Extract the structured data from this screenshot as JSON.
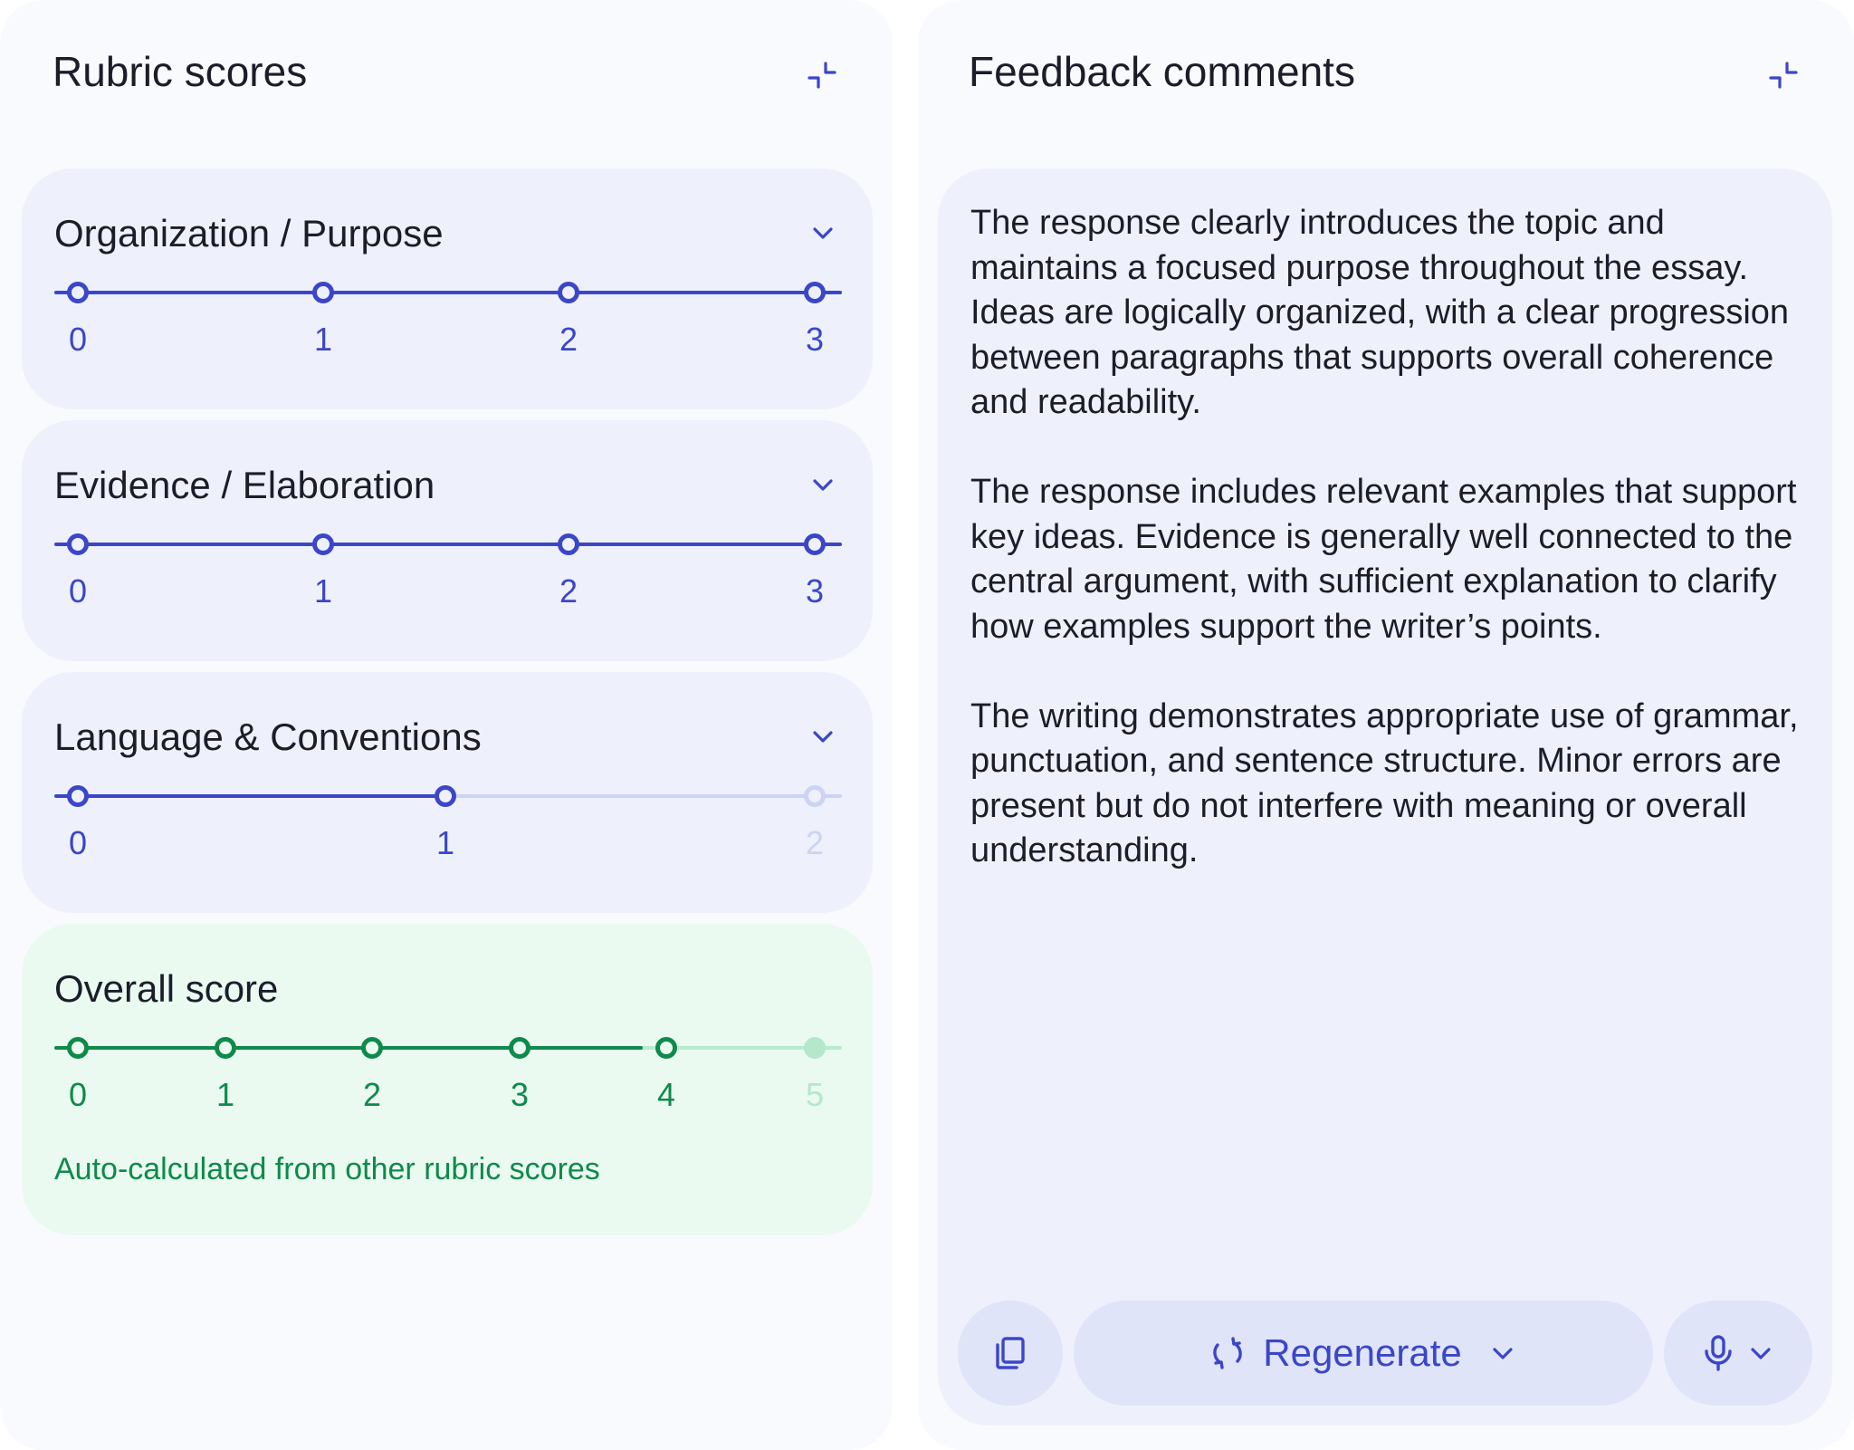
{
  "left": {
    "title": "Rubric scores",
    "collapse_icon": "collapse-icon",
    "cards": [
      {
        "title": "Organization / Purpose",
        "ticks": [
          "0",
          "1",
          "2",
          "3"
        ],
        "score": 3,
        "max": 3
      },
      {
        "title": "Evidence / Elaboration",
        "ticks": [
          "0",
          "1",
          "2",
          "3"
        ],
        "score": 3,
        "max": 3
      },
      {
        "title": "Language & Conventions",
        "ticks": [
          "0",
          "1",
          "2"
        ],
        "score": 1,
        "max": 2
      }
    ],
    "overall": {
      "title": "Overall score",
      "ticks": [
        "0",
        "1",
        "2",
        "3",
        "4",
        "5"
      ],
      "score": 4,
      "max": 5,
      "note": "Auto-calculated from other rubric scores"
    }
  },
  "right": {
    "title": "Feedback comments",
    "collapse_icon": "collapse-icon",
    "paragraphs": [
      "The response clearly introduces the topic and maintains a focused purpose throughout the essay. Ideas are logically organized, with a clear progression between paragraphs that supports overall coherence and readability.",
      "The response includes relevant examples that support key ideas. Evidence is generally well connected to the central argument, with sufficient explanation to clarify how examples support the writer’s points.",
      "The writing demonstrates appropriate use of grammar, punctuation, and sentence structure. Minor errors are present but do not interfere with meaning or overall understanding."
    ],
    "actions": {
      "copy_icon": "copy-icon",
      "regenerate_label": "Regenerate",
      "regenerate_icon": "refresh-icon",
      "mic_icon": "microphone-icon"
    }
  },
  "colors": {
    "accent_blue": "#3b46c8",
    "accent_green": "#0e8a4b",
    "card_bg": "#eef1fb",
    "green_card_bg": "#eafaf0"
  }
}
